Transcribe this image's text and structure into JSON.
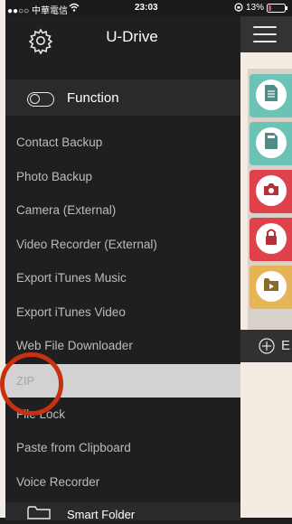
{
  "status_bar": {
    "carrier": "●●○○ 中華電信",
    "time": "23:03",
    "battery": "13%"
  },
  "drawer": {
    "title": "U-Drive",
    "section": {
      "label": "Function"
    },
    "items": [
      "Contact Backup",
      "Photo Backup",
      "Camera (External)",
      "Video Recorder (External)",
      "Export iTunes Music",
      "Export iTunes Video",
      "Web File Downloader",
      "ZIP",
      "File Lock",
      "Paste from Clipboard",
      "Voice Recorder"
    ],
    "smart_folder": {
      "label": "Smart Folder"
    }
  },
  "right_panel": {
    "bottom_bar_text": "E",
    "tiles": [
      {
        "icon": "document-icon",
        "color": "#6cc2b4"
      },
      {
        "icon": "sd-card-icon",
        "color": "#6cc2b4"
      },
      {
        "icon": "camera-icon",
        "color": "#e0424b"
      },
      {
        "icon": "lock-icon",
        "color": "#e0424b"
      },
      {
        "icon": "video-folder-icon",
        "color": "#e4b457"
      }
    ]
  },
  "colors": {
    "annotation": "#c8300f",
    "selected_row": "#d2d2d2"
  }
}
